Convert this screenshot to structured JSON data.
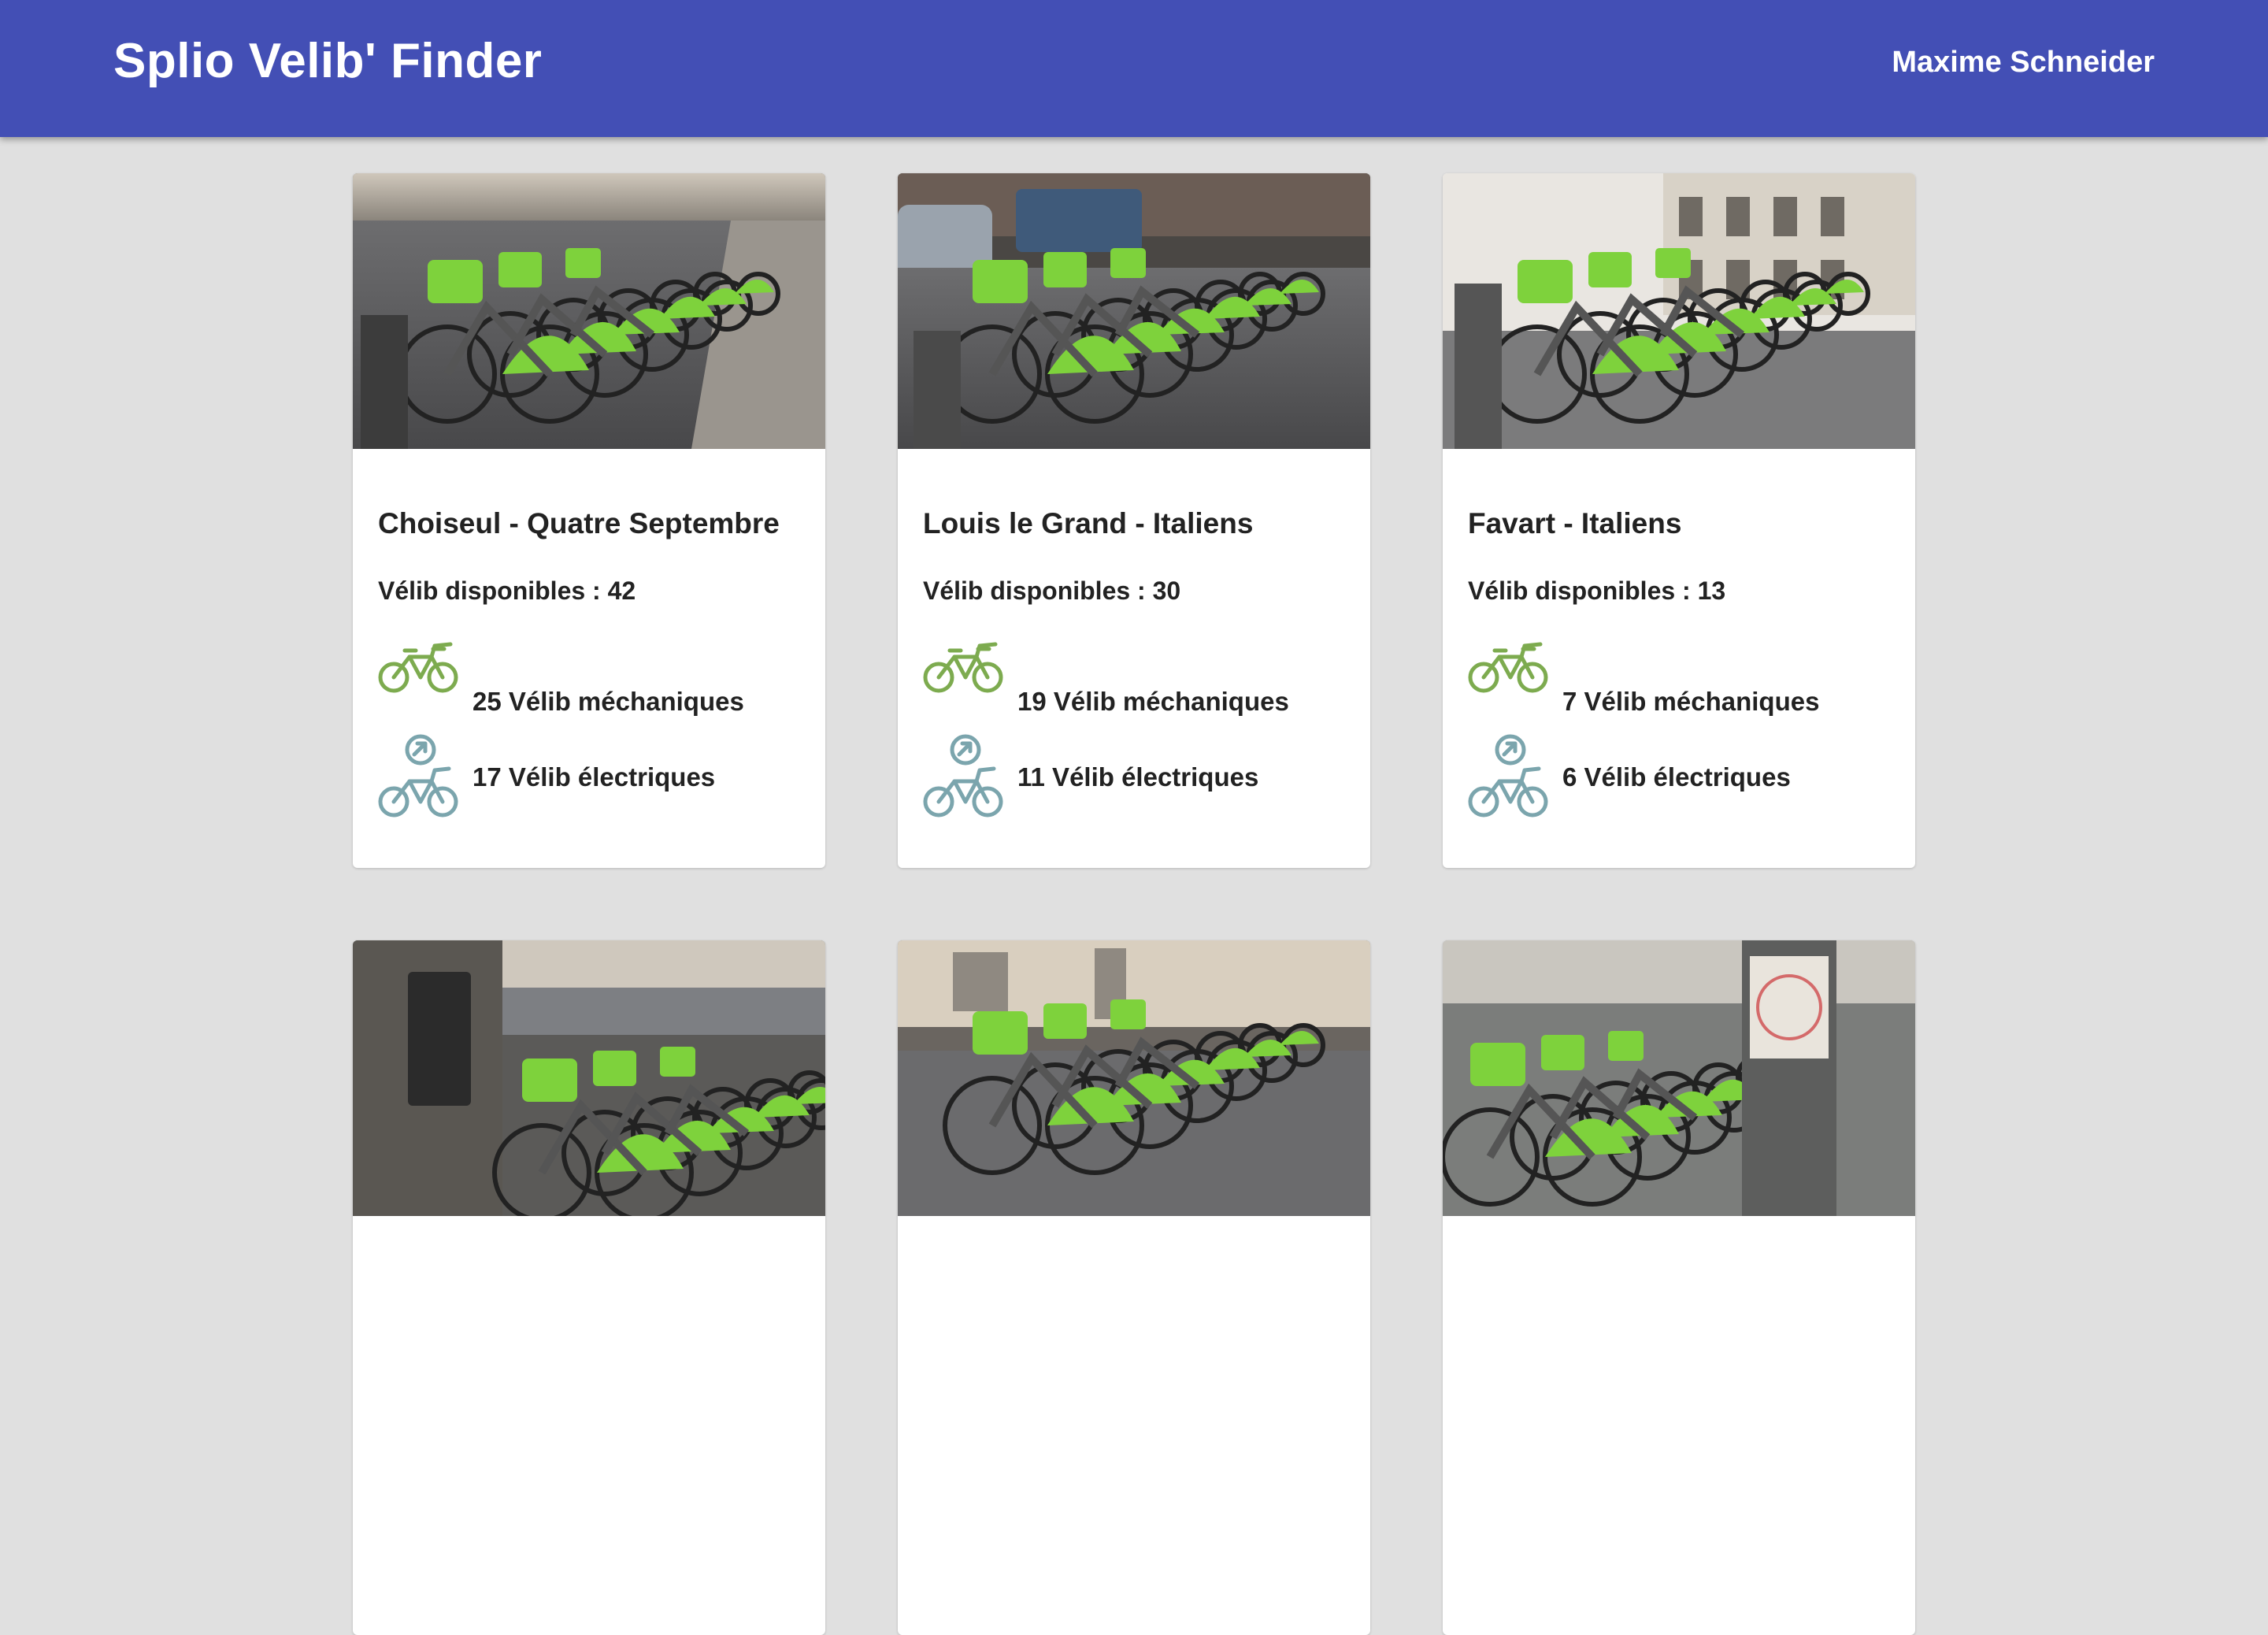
{
  "header": {
    "title": "Splio Velib' Finder",
    "user": "Maxime Schneider"
  },
  "colors": {
    "appbar": "#434fb5",
    "background": "#e0e0e0",
    "mechanical_icon": "#7dab4f",
    "electric_icon": "#7ba5ad"
  },
  "icons": {
    "mechanical": "bicycle-icon",
    "electric": "electric-bicycle-icon"
  },
  "stations": [
    {
      "name": "Choiseul - Quatre Septembre",
      "available": "Vélib disponibles : 42",
      "mechanical": "25 Vélib méchaniques",
      "electric": "17 Vélib électriques"
    },
    {
      "name": "Louis le Grand - Italiens",
      "available": "Vélib disponibles : 30",
      "mechanical": "19 Vélib méchaniques",
      "electric": "11 Vélib électriques"
    },
    {
      "name": "Favart - Italiens",
      "available": "Vélib disponibles : 13",
      "mechanical": "7 Vélib méchaniques",
      "electric": "6 Vélib électriques"
    },
    {
      "name": "",
      "available": "",
      "mechanical": "",
      "electric": ""
    },
    {
      "name": "",
      "available": "",
      "mechanical": "",
      "electric": ""
    },
    {
      "name": "",
      "available": "",
      "mechanical": "",
      "electric": ""
    }
  ]
}
